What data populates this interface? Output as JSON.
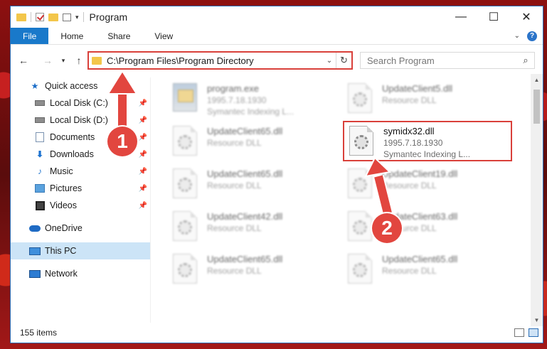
{
  "window": {
    "title": "Program",
    "controls": [
      "—",
      "☐",
      "✕"
    ]
  },
  "ribbon": {
    "tabs": [
      "File",
      "Home",
      "Share",
      "View"
    ],
    "help_icon": "?"
  },
  "address": {
    "path": "C:\\Program Files\\Program Directory",
    "search_placeholder": "Search Program"
  },
  "nav": {
    "quick_access": "Quick access",
    "items": [
      {
        "label": "Local Disk (C:)",
        "icon": "disk-icon"
      },
      {
        "label": "Local Disk (D:)",
        "icon": "disk-icon"
      },
      {
        "label": "Documents",
        "icon": "documents-icon"
      },
      {
        "label": "Downloads",
        "icon": "downloads-icon"
      },
      {
        "label": "Music",
        "icon": "music-icon"
      },
      {
        "label": "Pictures",
        "icon": "pictures-icon"
      },
      {
        "label": "Videos",
        "icon": "videos-icon"
      }
    ],
    "onedrive": "OneDrive",
    "this_pc": "This PC",
    "network": "Network"
  },
  "files": [
    {
      "name": "program.exe",
      "line2": "1995.7.18.1930",
      "line3": "Symantec Indexing L...",
      "type": "exe",
      "blurred": true
    },
    {
      "name": "UpdateClient5.dll",
      "line2": "Resource DLL",
      "line3": "",
      "type": "dll",
      "blurred": true
    },
    {
      "name": "UpdateClient65.dll",
      "line2": "Resource DLL",
      "line3": "",
      "type": "dll",
      "blurred": true
    },
    {
      "name": "symidx32.dll",
      "line2": "1995.7.18.1930",
      "line3": "Symantec Indexing L...",
      "type": "dll",
      "blurred": false
    },
    {
      "name": "UpdateClient65.dll",
      "line2": "Resource DLL",
      "line3": "",
      "type": "dll",
      "blurred": true
    },
    {
      "name": "UpdateClient19.dll",
      "line2": "Resource DLL",
      "line3": "",
      "type": "dll",
      "blurred": true
    },
    {
      "name": "UpdateClient42.dll",
      "line2": "Resource DLL",
      "line3": "",
      "type": "dll",
      "blurred": true
    },
    {
      "name": "UpdateClient63.dll",
      "line2": "Resource DLL",
      "line3": "",
      "type": "dll",
      "blurred": true
    },
    {
      "name": "UpdateClient65.dll",
      "line2": "Resource DLL",
      "line3": "",
      "type": "dll",
      "blurred": true
    },
    {
      "name": "UpdateClient65.dll",
      "line2": "Resource DLL",
      "line3": "",
      "type": "dll",
      "blurred": true
    }
  ],
  "status": {
    "item_count": "155 items"
  },
  "annotations": {
    "step1": "1",
    "step2": "2",
    "highlight_color": "#d9403a"
  }
}
